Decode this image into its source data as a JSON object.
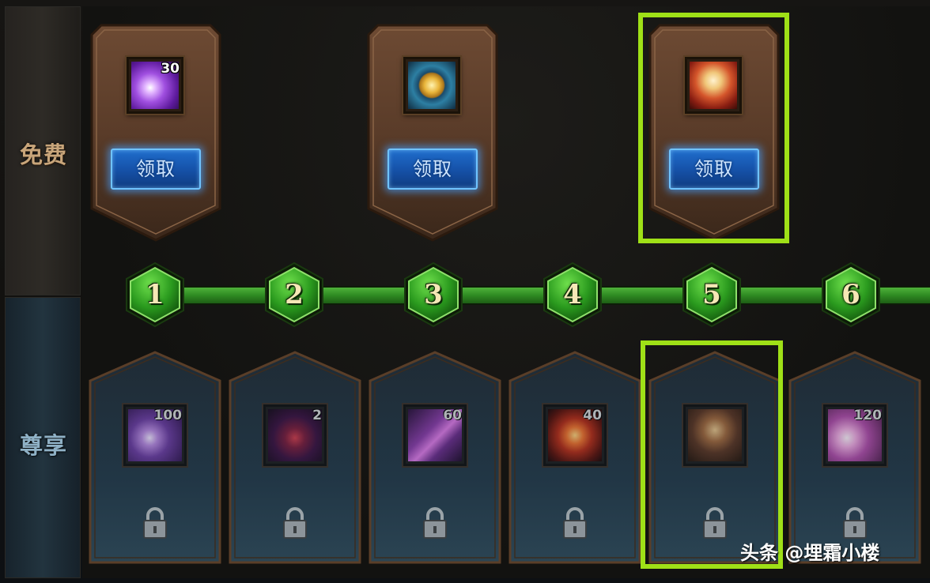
{
  "rows": {
    "free_label": "免费",
    "premium_label": "尊享"
  },
  "free_rewards": [
    {
      "level": 1,
      "icon": "purple-crystal-icon",
      "count": "30",
      "button": "领取"
    },
    {
      "level": 3,
      "icon": "gold-coin-icon",
      "count": "",
      "button": "领取"
    },
    {
      "level": 5,
      "icon": "hero-portrait-icon",
      "count": "",
      "button": "领取"
    }
  ],
  "levels": [
    "1",
    "2",
    "3",
    "4",
    "5",
    "6"
  ],
  "premium_rewards": [
    {
      "level": 1,
      "icon": "purple-crystal-icon",
      "count": "100",
      "locked": true
    },
    {
      "level": 2,
      "icon": "dark-gem-icon",
      "count": "2",
      "locked": true
    },
    {
      "level": 3,
      "icon": "violet-shard-icon",
      "count": "60",
      "locked": true
    },
    {
      "level": 4,
      "icon": "fire-orb-icon",
      "count": "40",
      "locked": true
    },
    {
      "level": 5,
      "icon": "treasure-chest-icon",
      "count": "",
      "locked": true
    },
    {
      "level": 6,
      "icon": "pink-crystal-icon",
      "count": "120",
      "locked": true
    }
  ],
  "colors": {
    "highlight": "#9fe017",
    "track_green": "#3f9e2c",
    "button_blue": "#1a5fbd"
  },
  "watermark": "头条 @埋霜小楼"
}
